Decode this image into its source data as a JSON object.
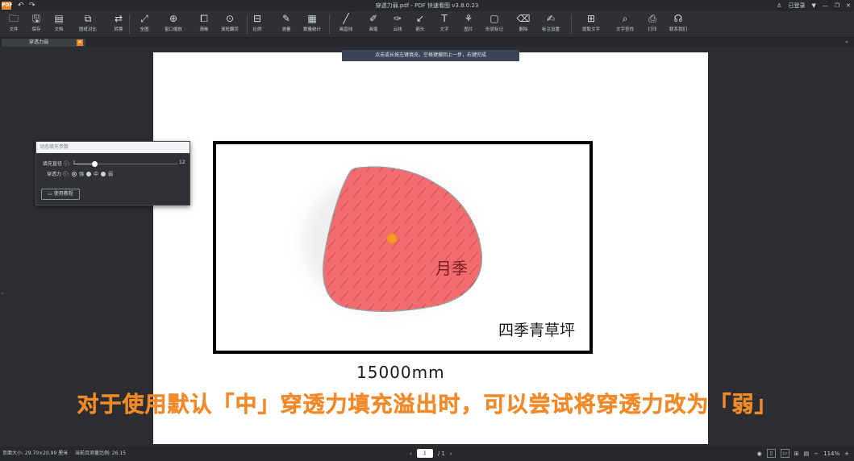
{
  "titlebar": {
    "logo": "PDF",
    "title": "穿透力弱.pdf - PDF 快速看图 v3.8.0.23",
    "login": "已登录"
  },
  "toolbar": {
    "items": [
      {
        "label": "文件",
        "icon": "folder-icon",
        "glyph": "🗀"
      },
      {
        "label": "保存",
        "icon": "save-icon",
        "glyph": "🖫"
      },
      {
        "label": "文档",
        "icon": "document-icon",
        "glyph": "▤"
      },
      {
        "label": "图纸对比",
        "icon": "compare-icon",
        "glyph": "⧉"
      },
      {
        "label": "转换",
        "icon": "convert-icon",
        "glyph": "⇄"
      },
      {
        "label": "全图",
        "icon": "fit-all-icon",
        "glyph": "⤢"
      },
      {
        "label": "窗口缩放",
        "icon": "zoom-window-icon",
        "glyph": "⊕"
      },
      {
        "label": "清晰",
        "icon": "clarity-icon",
        "glyph": "⧠"
      },
      {
        "label": "滚轮翻页",
        "icon": "mouse-wheel-icon",
        "glyph": "⊙"
      },
      {
        "label": "比例",
        "icon": "scale-icon",
        "glyph": "⊟"
      },
      {
        "label": "测量",
        "icon": "measure-icon",
        "glyph": "✎"
      },
      {
        "label": "数量统计",
        "icon": "count-icon",
        "glyph": "▦"
      },
      {
        "label": "画直线",
        "icon": "line-icon",
        "glyph": "╱"
      },
      {
        "label": "画笔",
        "icon": "pen-icon",
        "glyph": "✐"
      },
      {
        "label": "云线",
        "icon": "cloud-icon",
        "glyph": "✑"
      },
      {
        "label": "箭头",
        "icon": "arrow-icon",
        "glyph": "↙"
      },
      {
        "label": "文字",
        "icon": "text-icon",
        "glyph": "T"
      },
      {
        "label": "图片",
        "icon": "image-icon",
        "glyph": "⚘"
      },
      {
        "label": "形状标记",
        "icon": "shape-icon",
        "glyph": "▢"
      },
      {
        "label": "删除",
        "icon": "eraser-icon",
        "glyph": "⌫"
      },
      {
        "label": "标注设置",
        "icon": "annotation-settings-icon",
        "glyph": "✍"
      },
      {
        "label": "提取文字",
        "icon": "extract-text-icon",
        "glyph": "⊞"
      },
      {
        "label": "文字查找",
        "icon": "search-icon",
        "glyph": "⌕"
      },
      {
        "label": "打印",
        "icon": "print-icon",
        "glyph": "⎙"
      },
      {
        "label": "联系我们",
        "icon": "headset-icon",
        "glyph": "☊"
      }
    ]
  },
  "tab": {
    "label": "穿透力弱",
    "close": "✕"
  },
  "hint": "点击或长按左键填充，空格键撤回上一步，右键完成",
  "fill_panel": {
    "title": "动态填充参数",
    "diameter_label": "填充直径 ⓘ:",
    "diameter_min": "1",
    "diameter_max": "12",
    "diameter_fraction": 0.19,
    "penetration_label": "穿透力 ⓘ:",
    "options": [
      "强",
      "中",
      "弱"
    ],
    "selected": "强",
    "tutorial_button": "使用教程"
  },
  "drawing": {
    "annotation": "月季",
    "area_label": "四季青草坪",
    "dimension": "15000mm"
  },
  "subtitle": "对于使用默认「中」穿透力填充溢出时，可以尝试将穿透力改为「弱」",
  "statusbar": {
    "page_size": "页面大小: 29.70×20.99 厘米",
    "measure_scale": "当前页测量比例: 26.15",
    "page_current": "1",
    "page_total": "/ 1",
    "zoom": "114%"
  },
  "colors": {
    "fill": "#f26b6e",
    "accent": "#e9842b",
    "subtitle": "#f08a2a"
  }
}
